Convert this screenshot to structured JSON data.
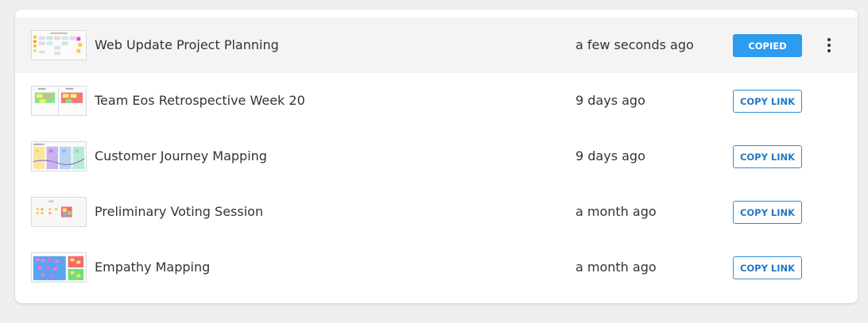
{
  "boards": [
    {
      "title": "Web Update Project Planning",
      "time": "a few seconds ago",
      "button": "COPIED",
      "active": true,
      "thumb": "planning-board-thumbnail-icon"
    },
    {
      "title": "Team Eos Retrospective Week 20",
      "time": "9 days ago",
      "button": "COPY LINK",
      "active": false,
      "thumb": "retrospective-board-thumbnail-icon"
    },
    {
      "title": "Customer Journey Mapping",
      "time": "9 days ago",
      "button": "COPY LINK",
      "active": false,
      "thumb": "journey-map-thumbnail-icon"
    },
    {
      "title": "Preliminary Voting Session",
      "time": "a month ago",
      "button": "COPY LINK",
      "active": false,
      "thumb": "voting-board-thumbnail-icon"
    },
    {
      "title": "Empathy Mapping",
      "time": "a month ago",
      "button": "COPY LINK",
      "active": false,
      "thumb": "empathy-map-thumbnail-icon"
    }
  ],
  "menu_icon": "more-vertical-icon",
  "colors": {
    "accent": "#2d9cef",
    "active_row": "#f4f4f4",
    "text": "#333333"
  }
}
